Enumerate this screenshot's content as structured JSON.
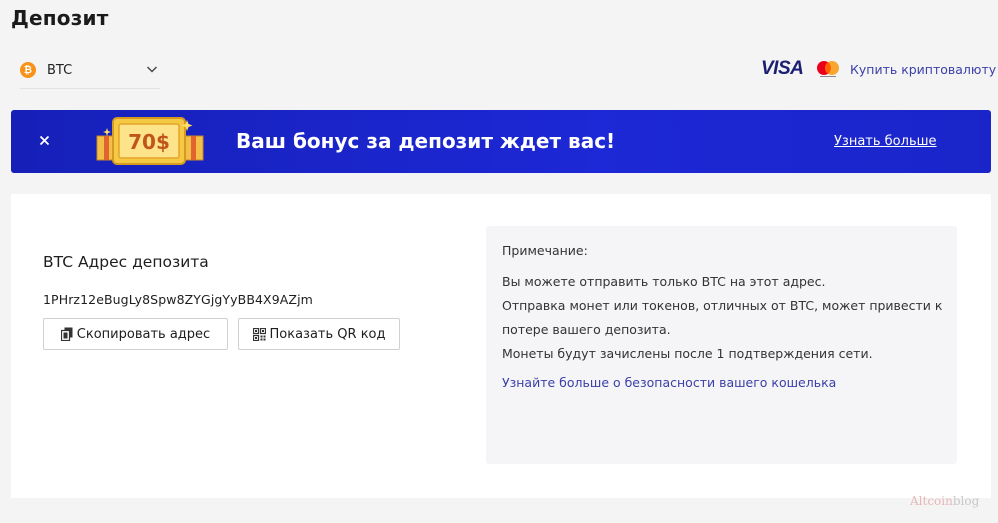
{
  "page": {
    "title": "Депозит"
  },
  "currency_select": {
    "coin_symbol": "₿",
    "selected": "BTC"
  },
  "buy_crypto": {
    "visa": "VISA",
    "link": "Купить криптовалюту"
  },
  "banner": {
    "badge": "70$",
    "text": "Ваш бонус за депозит ждет вас!",
    "learn_more": "Узнать больше"
  },
  "deposit": {
    "heading": "BTC Адрес депозита",
    "address": "1PHrz12eBugLy8Spw8ZYGjgYyBB4X9AZjm",
    "copy_label": "Скопировать адрес",
    "qr_label": "Показать QR код"
  },
  "note": {
    "title": "Примечание:",
    "lines": [
      "Вы можете отправить только BTC на этот адрес.",
      "Отправка монет или токенов, отличных от BTC, может привести к",
      "потере вашего депозита.",
      "Монеты будут зачислены после 1 подтверждения сети."
    ],
    "link": "Узнайте больше о безопасности вашего кошелька"
  },
  "watermark": {
    "part1": "Altcoin",
    "part2": "blog"
  },
  "colors": {
    "accent": "#3b3fa8",
    "banner": "#1d28d6",
    "btc": "#f7931a",
    "background": "#f4f4f5"
  },
  "icons": [
    "bitcoin-icon",
    "chevron-down-icon",
    "mastercard-icon",
    "close-icon",
    "copy-icon",
    "qr-code-icon"
  ]
}
